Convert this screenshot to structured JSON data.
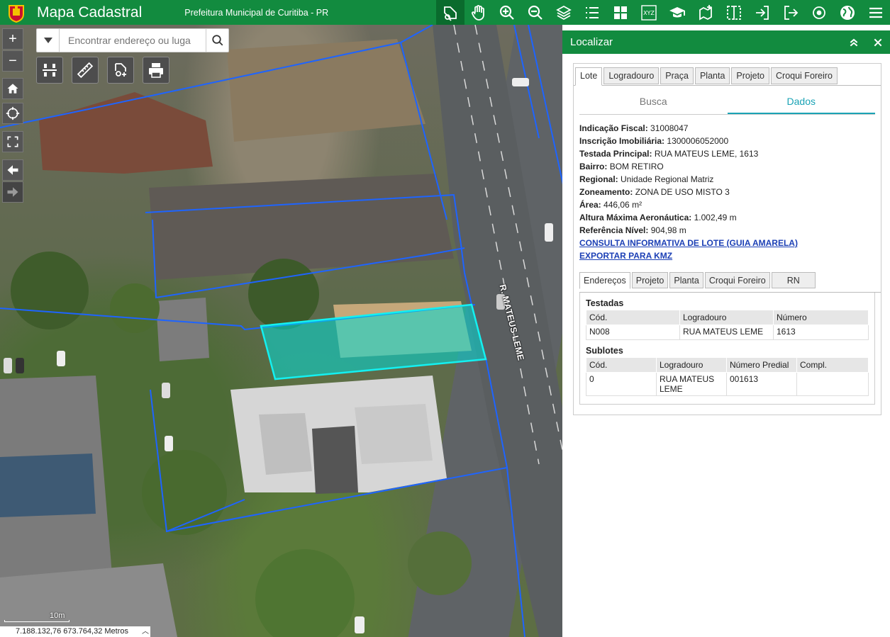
{
  "header": {
    "app_title": "Mapa Cadastral",
    "subtitle": "Prefeitura Municipal de Curitiba - PR",
    "brand_color": "#128b3f",
    "toolbar_icons": [
      "identify-tool-icon",
      "pan-hand-icon",
      "zoom-in-icon",
      "zoom-out-icon",
      "layers-icon",
      "legend-list-icon",
      "basemap-grid-icon",
      "xyz-coordinates-icon",
      "education-cap-icon",
      "add-map-icon",
      "compare-split-icon",
      "login-icon",
      "logout-icon",
      "locate-target-icon",
      "globe-icon",
      "menu-icon"
    ]
  },
  "search": {
    "placeholder": "Encontrar endereço ou luga"
  },
  "map": {
    "street_label": "R. MATEUS LEME",
    "scale_label": "10m",
    "coordinates": "7.188.132,76 673.764,32 Metros"
  },
  "panel": {
    "title": "Localizar",
    "tabs": [
      "Lote",
      "Logradouro",
      "Praça",
      "Planta",
      "Projeto",
      "Croqui Foreiro"
    ],
    "active_tab": "Lote",
    "subtabs": [
      "Busca",
      "Dados"
    ],
    "active_subtab": "Dados",
    "fields": [
      {
        "label": "Indicação Fiscal:",
        "value": "31008047"
      },
      {
        "label": "Inscrição Imobiliária:",
        "value": "1300006052000"
      },
      {
        "label": "Testada Principal:",
        "value": "RUA MATEUS LEME, 1613"
      },
      {
        "label": "Bairro:",
        "value": "BOM RETIRO"
      },
      {
        "label": "Regional:",
        "value": "Unidade Regional Matriz"
      },
      {
        "label": "Zoneamento:",
        "value": "ZONA DE USO MISTO 3"
      },
      {
        "label": "Área:",
        "value": "446,06 m²"
      },
      {
        "label": "Altura Máxima Aeronáutica:",
        "value": "1.002,49 m"
      },
      {
        "label": "Referência Nível:",
        "value": "904,98 m"
      }
    ],
    "links": [
      "CONSULTA INFORMATIVA DE LOTE (GUIA AMARELA)",
      "EXPORTAR PARA KMZ"
    ],
    "inner_tabs": [
      "Endereços",
      "Projeto",
      "Planta",
      "Croqui Foreiro",
      "RN"
    ],
    "active_inner_tab": "Endereços",
    "testadas": {
      "title": "Testadas",
      "headers": [
        "Cód.",
        "Logradouro",
        "Número"
      ],
      "rows": [
        [
          "N008",
          "RUA MATEUS LEME",
          "1613"
        ]
      ]
    },
    "sublotes": {
      "title": "Sublotes",
      "headers": [
        "Cód.",
        "Logradouro",
        "Número Predial",
        "Compl."
      ],
      "rows": [
        [
          "0",
          "RUA MATEUS LEME",
          "001613",
          ""
        ]
      ]
    }
  }
}
